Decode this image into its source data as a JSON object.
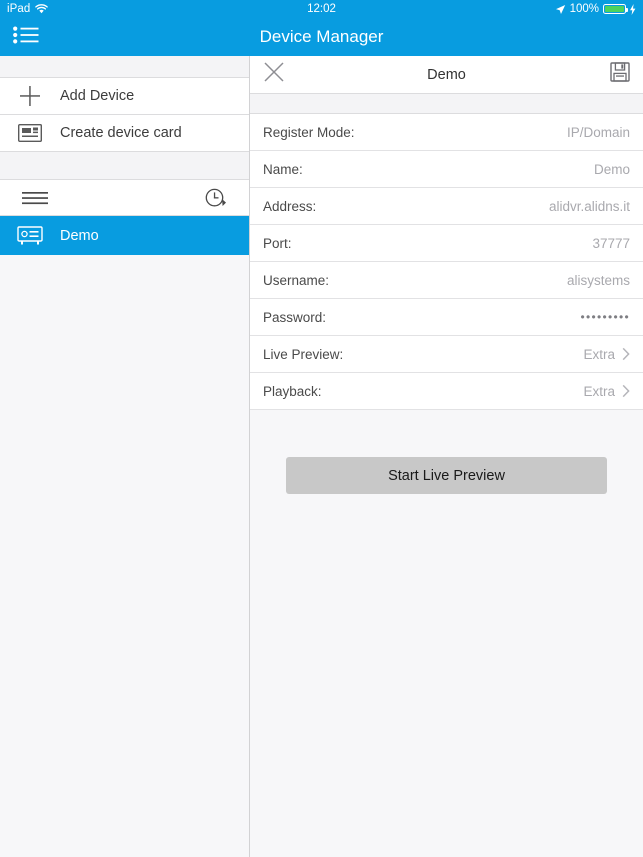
{
  "status_bar": {
    "carrier": "iPad",
    "wifi_icon": "wifi-icon",
    "time": "12:02",
    "location_icon": "location-arrow-icon",
    "battery_percent": "100%",
    "battery_icon": "battery-full-icon",
    "charging_icon": "lightning-bolt-icon",
    "background": "#089ce0",
    "foreground": "#ffffff"
  },
  "navbar": {
    "menu_icon": "list-menu-icon",
    "title": "Device Manager",
    "background": "#089ce0"
  },
  "sidebar": {
    "items": [
      {
        "label": "Add Device",
        "icon": "plus-icon"
      },
      {
        "label": "Create device card",
        "icon": "device-card-icon"
      }
    ],
    "toolbar": {
      "menu_icon": "hamburger-icon",
      "history_icon": "clock-history-icon"
    },
    "device": {
      "label": "Demo",
      "icon": "dvr-device-icon",
      "selected": true,
      "selected_color": "#089ce0"
    }
  },
  "detail": {
    "header": {
      "close_icon": "close-x-icon",
      "title": "Demo",
      "save_icon": "floppy-save-icon"
    },
    "fields": [
      {
        "label": "Register Mode:",
        "value": "IP/Domain",
        "chevron": false,
        "type": "text"
      },
      {
        "label": "Name:",
        "value": "Demo",
        "chevron": false,
        "type": "text"
      },
      {
        "label": "Address:",
        "value": "alidvr.alidns.it",
        "chevron": false,
        "type": "text"
      },
      {
        "label": "Port:",
        "value": "37777",
        "chevron": false,
        "type": "text"
      },
      {
        "label": "Username:",
        "value": "alisystems",
        "chevron": false,
        "type": "text"
      },
      {
        "label": "Password:",
        "value": "•••••••••",
        "chevron": false,
        "type": "password"
      },
      {
        "label": "Live Preview:",
        "value": "Extra",
        "chevron": true,
        "type": "link"
      },
      {
        "label": "Playback:",
        "value": "Extra",
        "chevron": true,
        "type": "link"
      }
    ],
    "primary_button": {
      "label": "Start Live Preview",
      "background": "#c8c8c8"
    }
  }
}
